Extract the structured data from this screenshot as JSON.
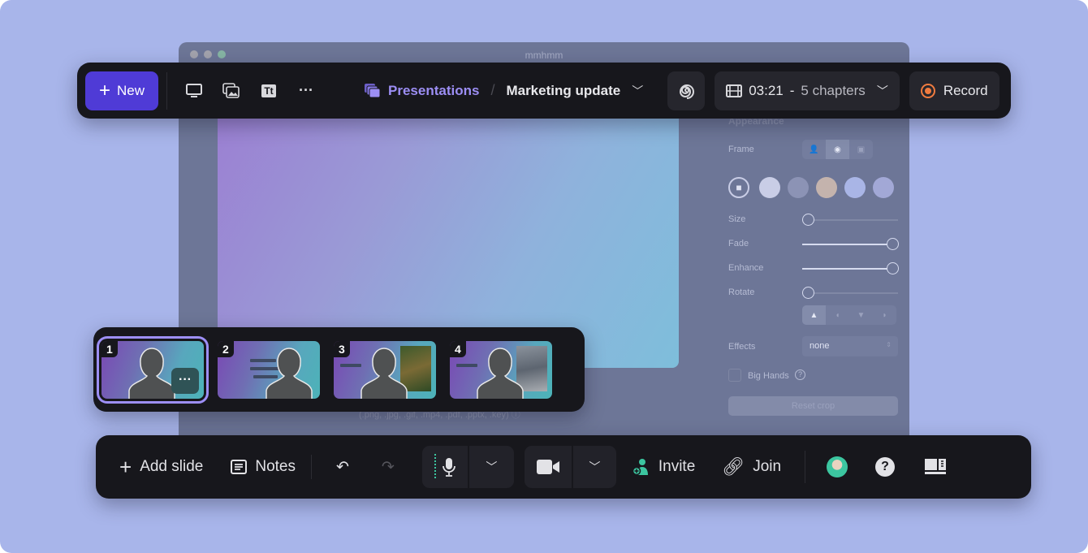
{
  "window": {
    "title": "mmhmm"
  },
  "slide": {
    "supported_formats_hint": "(.png, .jpg, .gif, .mp4, .pdf, .pptx, .key) ⓘ"
  },
  "panel": {
    "section": "Appearance",
    "frame_label": "Frame",
    "size_label": "Size",
    "size_value": 0,
    "fade_label": "Fade",
    "fade_value": 100,
    "enhance_label": "Enhance",
    "enhance_value": 100,
    "rotate_label": "Rotate",
    "rotate_value": 0,
    "effects_label": "Effects",
    "effects_value": "none",
    "big_hands_label": "Big Hands",
    "big_hands_checked": false,
    "reset_crop_label": "Reset crop",
    "swatch_colors": [
      "#c9cde6",
      "#8c93b5",
      "#c4b3ad",
      "#a9b5e6",
      "#a2a8d6"
    ]
  },
  "top_toolbar": {
    "new_label": "New",
    "breadcrumb_root": "Presentations",
    "breadcrumb_current": "Marketing update",
    "duration": "03:21",
    "chapters": "5 chapters",
    "record_label": "Record"
  },
  "slides": [
    {
      "number": "1",
      "selected": true
    },
    {
      "number": "2",
      "selected": false
    },
    {
      "number": "3",
      "selected": false
    },
    {
      "number": "4",
      "selected": false
    }
  ],
  "slide_more_label": "···",
  "bottom_toolbar": {
    "add_slide_label": "Add slide",
    "notes_label": "Notes",
    "invite_label": "Invite",
    "join_label": "Join"
  },
  "colors": {
    "accent": "#4f3bd6",
    "brand_text": "#9c8ef4",
    "record": "#f07b3f",
    "invite": "#3cc6a0",
    "background": "#a8b5ea"
  }
}
